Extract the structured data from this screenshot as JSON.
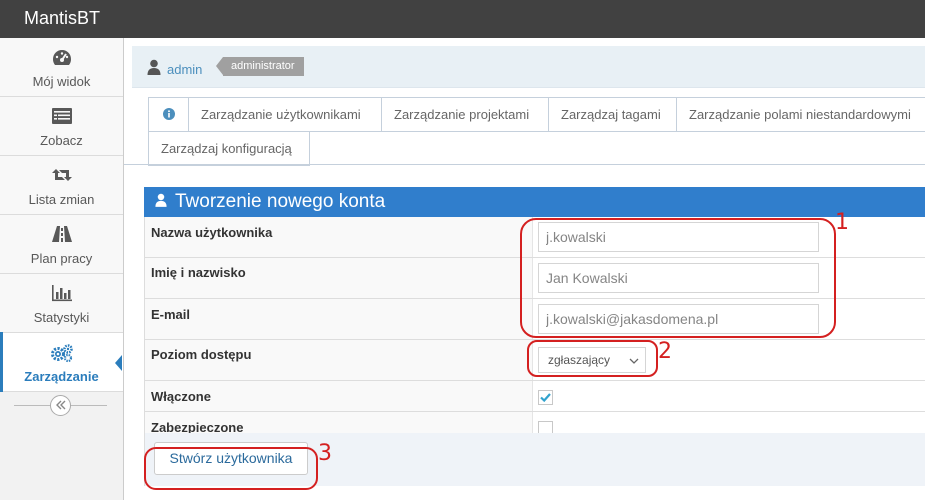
{
  "app": {
    "title": "MantisBT"
  },
  "sidebar": {
    "items": [
      {
        "label": "Mój widok",
        "icon": "dashboard-icon"
      },
      {
        "label": "Zobacz",
        "icon": "list-icon"
      },
      {
        "label": "Lista zmian",
        "icon": "retweet-icon"
      },
      {
        "label": "Plan pracy",
        "icon": "road-icon"
      },
      {
        "label": "Statystyki",
        "icon": "bar-chart-icon"
      },
      {
        "label": "Zarządzanie",
        "icon": "gears-icon",
        "active": true
      }
    ],
    "collapse_icon": "double-chevron-left-icon"
  },
  "breadcrumb": {
    "user": "admin",
    "role": "administrator"
  },
  "tabs": [
    {
      "label": "",
      "icon": "info-icon"
    },
    {
      "label": "Zarządzanie użytkownikami"
    },
    {
      "label": "Zarządzanie projektami"
    },
    {
      "label": "Zarządzaj tagami"
    },
    {
      "label": "Zarządzanie polami niestandardowymi"
    },
    {
      "label": "Zarządzaj konfiguracją"
    }
  ],
  "form": {
    "title": "Tworzenie nowego konta",
    "username": {
      "label": "Nazwa użytkownika",
      "value": "j.kowalski"
    },
    "realname": {
      "label": "Imię i nazwisko",
      "value": "Jan Kowalski"
    },
    "email": {
      "label": "E-mail",
      "value": "j.kowalski@jakasdomena.pl"
    },
    "access_level": {
      "label": "Poziom dostępu",
      "value": "zgłaszający"
    },
    "enabled": {
      "label": "Włączone",
      "checked": true
    },
    "protected": {
      "label": "Zabezpieczone",
      "checked": false
    },
    "submit_label": "Stwórz użytkownika"
  },
  "annotations": [
    "1",
    "2",
    "3"
  ],
  "colors": {
    "accent": "#2b7dbc",
    "header": "#307ecc",
    "annotation": "#d42020",
    "topbar": "#414141"
  }
}
